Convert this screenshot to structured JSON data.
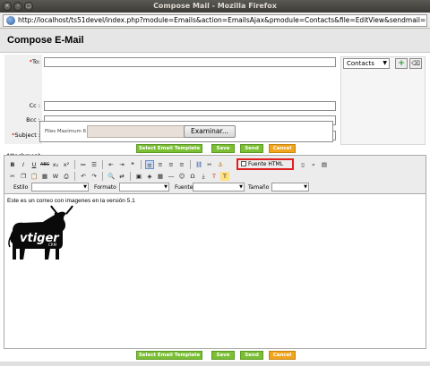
{
  "window": {
    "title": "Compose Mail - Mozilla Firefox"
  },
  "browser": {
    "url": "http://localhost/ts51devel/index.php?module=Emails&action=EmailsAjax&pmodule=Contacts&file=EditView&sendmail="
  },
  "compose": {
    "title": "Compose E-Mail",
    "to_label": "To:",
    "cc_label": "Cc :",
    "bcc_label": "Bcc :",
    "subject_label": "Subject :",
    "attachment_label": "Attachment :",
    "files_max": "Files Maximum 6",
    "browse_label": "Examinar...",
    "contacts_select": "Contacts"
  },
  "buttons": {
    "select_template": "Select Email Template",
    "save": "Save",
    "send": "Send",
    "cancel": "Cancel"
  },
  "editor": {
    "fuente_html": "Fuente HTML",
    "estilo_label": "Estilo",
    "formato_label": "Formato",
    "fuente_label": "Fuente",
    "tamano_label": "Tamaño",
    "body_text": "Este es un correo con imagenes en la versión 5.1",
    "logo_text": "vtiger",
    "logo_sub": "CRM"
  },
  "colors": {
    "green": "#7bbf35",
    "orange": "#f2a51c",
    "highlight": "#e02020"
  }
}
